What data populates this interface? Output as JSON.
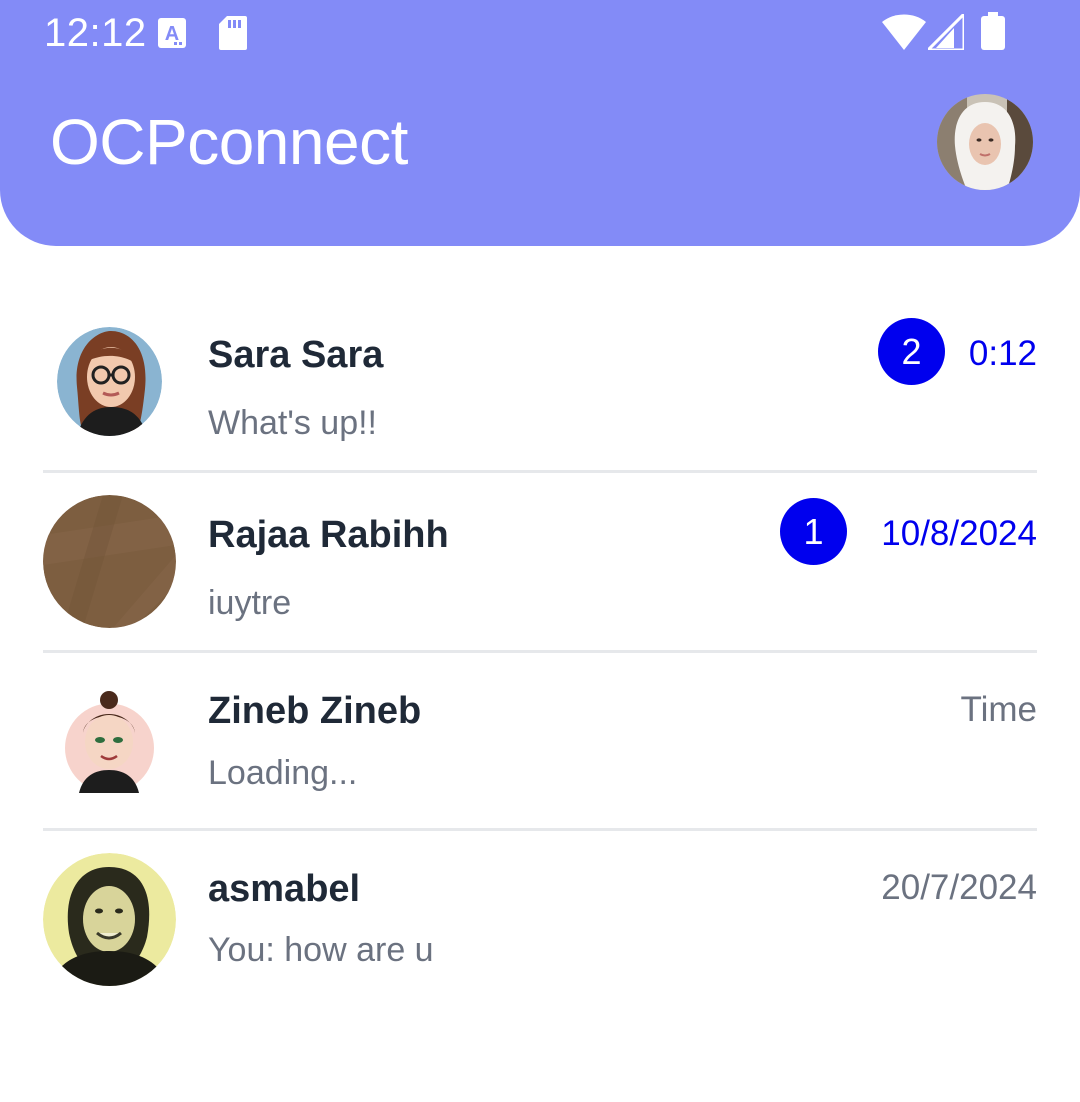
{
  "status_bar": {
    "time": "12:12",
    "icons": [
      "text-accessibility-icon",
      "sd-card-icon",
      "wifi-icon",
      "signal-icon",
      "battery-icon"
    ]
  },
  "header": {
    "title": "OCPconnect",
    "profile_avatar": "profile-avatar"
  },
  "colors": {
    "header_bg": "#838bf7",
    "badge_bg": "#0000ee",
    "unread_time": "#0000ee",
    "name_text": "#1f2937",
    "secondary_text": "#6b7280",
    "divider": "#e6e8eb"
  },
  "chats": [
    {
      "name": "Sara Sara",
      "preview": "What's up!!",
      "time": "0:12",
      "unread_count": "2"
    },
    {
      "name": "Rajaa Rabihh",
      "preview": "iuytre",
      "time": "10/8/2024",
      "unread_count": "1"
    },
    {
      "name": "Zineb Zineb",
      "preview": "Loading...",
      "time": "Time",
      "unread_count": null
    },
    {
      "name": "asmabel",
      "preview": "You: how are u",
      "time": "20/7/2024",
      "unread_count": null
    }
  ]
}
